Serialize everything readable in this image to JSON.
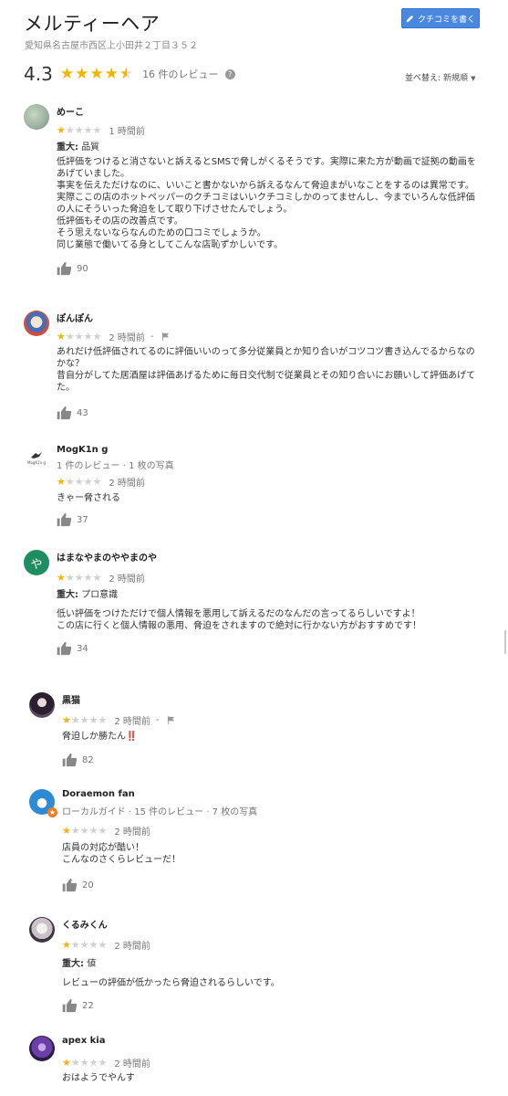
{
  "header": {
    "title": "メルティーヘア",
    "address": "愛知県名古屋市西区上小田井２丁目３５２",
    "write_review": "クチコミを書く",
    "rating": "4.3",
    "review_count": "16 件のレビュー",
    "sort_label": "並べ替え:",
    "sort_value": "新規順"
  },
  "reviews": [
    {
      "name": "めーこ",
      "stars": 1,
      "time": "1 時間前",
      "criticism_label": "重大:",
      "criticism_value": "品質",
      "body": "低評価をつけると消さないと訴えるとSMSで脅しがくるそうです。実際に来た方が動画で証拠の動画を\nあげていました。\n事実を伝えただけなのに、いいこと書かないから訴えるなんて脅迫まがいなことをするのは異常です。\n実際ここの店のホットペッパーのクチコミはいいクチコミしかのってませんし、今までいろんな低評価\nの人にそういった脅迫をして取り下げさせたんでしょう。\n低評価もその店の改善点です。\nそう思えないならなんのための口コミでしょうか。\n同じ業態で働いてる身としてこんな店恥ずかしいです。",
      "likes": "90"
    },
    {
      "name": "ぽんぽん",
      "stars": 1,
      "time": "2 時間前",
      "dot": "-",
      "body": "あれだけ低評価されてるのに評価いいのって多分従業員とか知り合いがコツコツ書き込んでるからなの\nかな？\n昔自分がしてた居酒屋は評価あげるために毎日交代制で従業員とその知り合いにお願いして評価あげて\nた。",
      "likes": "43"
    },
    {
      "name": "MogK1n g",
      "sub": "1 件のレビュー · 1 枚の写真",
      "avatar_text": "MogK1n g",
      "stars": 1,
      "time": "2 時間前",
      "body": "きゃー脅される",
      "likes": "37"
    },
    {
      "name": "はまなやまのややまのや",
      "avatar_letter": "や",
      "stars": 1,
      "time": "2 時間前",
      "criticism_label": "重大:",
      "criticism_value": "プロ意識",
      "body": "低い評価をつけただけで個人情報を悪用して訴えるだのなんだの言ってるらしいですよ！\nこの店に行くと個人情報の悪用、脅迫をされますので絶対に行かない方がおすすめです！",
      "likes": "34"
    },
    {
      "name": "黒猫",
      "stars": 1,
      "time": "2 時間前",
      "dot": "-",
      "body": "脅迫しか勝たん‼️",
      "likes": "82"
    },
    {
      "name": "Doraemon fan",
      "sub": "ローカルガイド · 15 件のレビュー · 7 枚の写真",
      "stars": 1,
      "time": "2 時間前",
      "body": "店員の対応が酷い！\nこんなのさくらレビューだ！",
      "likes": "20"
    },
    {
      "name": "くるみくん",
      "stars": 1,
      "time": "2 時間前",
      "criticism_label": "重大:",
      "criticism_value": "値",
      "body": "レビューの評価が低かったら脅迫されるらしいです。",
      "likes": "22"
    },
    {
      "name": "apex kia",
      "stars": 1,
      "time": "2 時間前",
      "body": "おはようでやんす"
    }
  ],
  "colors": {
    "star": "#f6b400",
    "button": "#4a88e0",
    "avatar_green": "#1e8e60"
  }
}
